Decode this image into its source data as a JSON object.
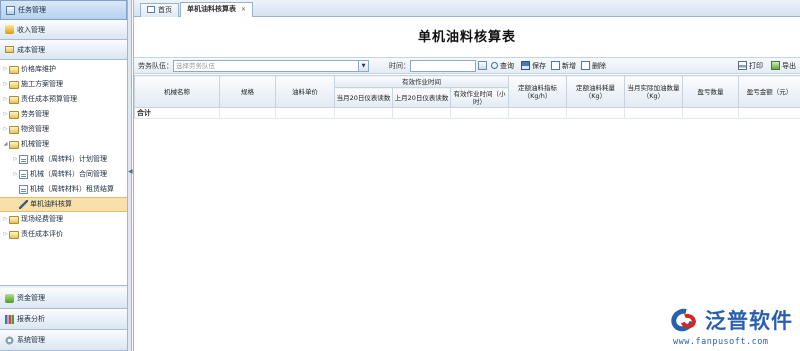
{
  "sidebar": {
    "top_header": "任务管理",
    "headers": [
      "收入管理",
      "成本管理"
    ],
    "tree": [
      {
        "label": "价格库维护",
        "indent": 0
      },
      {
        "label": "施工方案管理",
        "indent": 0
      },
      {
        "label": "责任成本预算管理",
        "indent": 0
      },
      {
        "label": "劳务管理",
        "indent": 0
      },
      {
        "label": "物资管理",
        "indent": 0
      },
      {
        "label": "机械管理",
        "indent": 0
      },
      {
        "label": "机械（周转料）计划管理",
        "indent": 1
      },
      {
        "label": "机械（周转料）合同管理",
        "indent": 1
      },
      {
        "label": "机械（周转材料）租赁结算",
        "indent": 1
      },
      {
        "label": "单机油料核算",
        "indent": 1
      },
      {
        "label": "现场经费管理",
        "indent": 0
      },
      {
        "label": "责任成本评价",
        "indent": 0
      }
    ],
    "bottom_headers": [
      "资金管理",
      "报表分析",
      "系统管理"
    ]
  },
  "tabs": {
    "home": "首页",
    "current": "单机油料核算表"
  },
  "page_title": "单机油料核算表",
  "toolbar": {
    "team_label": "劳务队伍：",
    "team_placeholder": "选择劳务队伍",
    "time_label": "时间：",
    "query": "查询",
    "save": "保存",
    "add": "新增",
    "delete": "删除",
    "print": "打印",
    "export": "导出"
  },
  "grid": {
    "headers": {
      "machine_name": "机械名称",
      "spec": "规格",
      "fuel_unit": "油料单价",
      "effective_time": "有效作业时间",
      "reading_20": "当月20日仪表读数",
      "last_reading_20": "上月20日仪表读数",
      "effective_hours": "有效作业时间（小时）",
      "quota_index": "定额油料指标（Kg/h）",
      "quota_consumption": "定额油料耗量（Kg）",
      "actual_refuel": "当月实际加油数量（Kg）",
      "surplus_qty": "盈亏数量",
      "surplus_amount": "盈亏金额（元）"
    },
    "total_label": "合计"
  },
  "logo": {
    "name": "泛普软件",
    "url": "www.fanpusoft.com"
  }
}
